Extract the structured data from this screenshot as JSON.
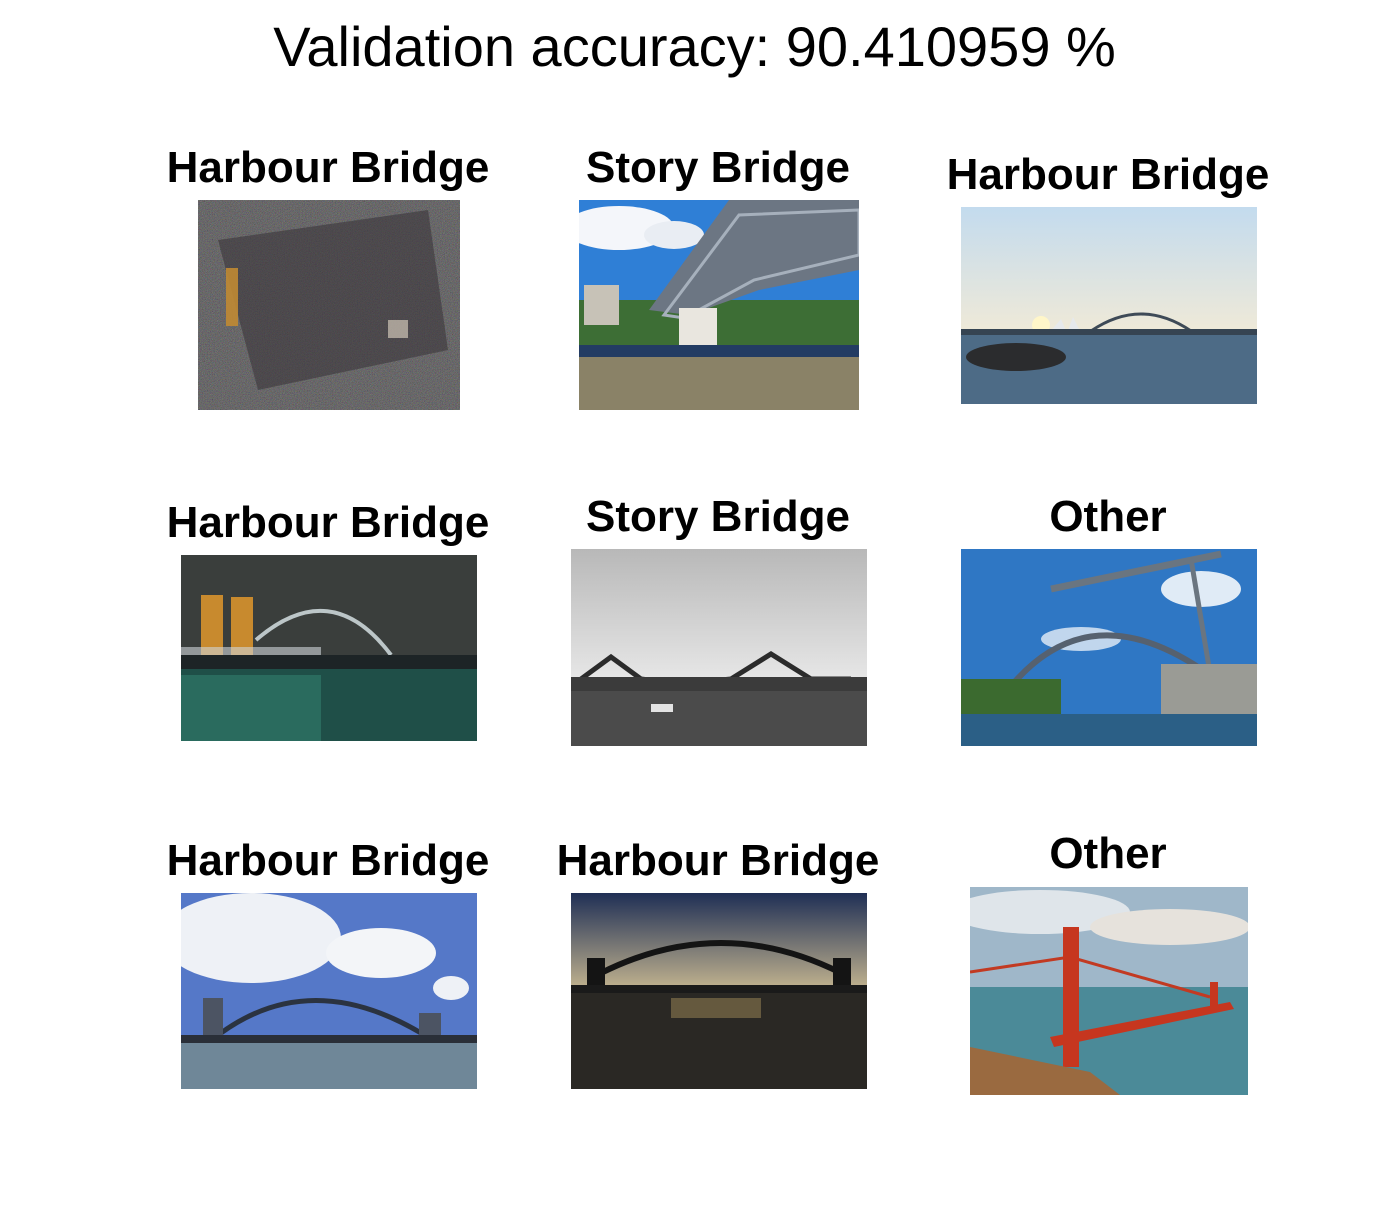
{
  "figure": {
    "title": "Validation accuracy: 90.410959 %"
  },
  "tiles": [
    {
      "label": "Harbour Bridge",
      "scene": "noisy-dark-photo"
    },
    {
      "label": "Story Bridge",
      "scene": "steel-truss-bridge-blue-sky"
    },
    {
      "label": "Harbour Bridge",
      "scene": "sunset-harbour-opera-house"
    },
    {
      "label": "Harbour Bridge",
      "scene": "night-arch-bridge-lights"
    },
    {
      "label": "Story Bridge",
      "scene": "cantilever-bridge-grey-sky"
    },
    {
      "label": "Other",
      "scene": "steel-arch-bridge-river"
    },
    {
      "label": "Harbour Bridge",
      "scene": "arch-bridge-cloudy-sky"
    },
    {
      "label": "Harbour Bridge",
      "scene": "arch-bridge-dusk-silhouette"
    },
    {
      "label": "Other",
      "scene": "red-suspension-bridge"
    }
  ]
}
